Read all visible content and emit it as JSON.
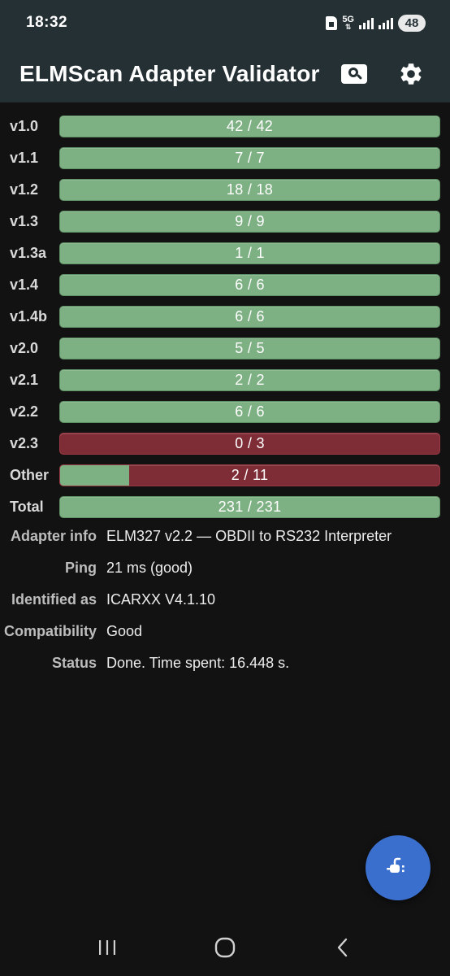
{
  "status_bar": {
    "time": "18:32",
    "network": "5G",
    "battery": "48"
  },
  "app_bar": {
    "title": "ELMScan Adapter Validator",
    "search_icon": "search-icon",
    "settings_icon": "gear-icon"
  },
  "colors": {
    "pass": "#7db082",
    "fail": "#7e2c35",
    "appbar": "#253035",
    "fab": "#3a6fce"
  },
  "results": [
    {
      "label": "v1.0",
      "value": "42 / 42",
      "passed": 42,
      "total": 42
    },
    {
      "label": "v1.1",
      "value": "7 / 7",
      "passed": 7,
      "total": 7
    },
    {
      "label": "v1.2",
      "value": "18 / 18",
      "passed": 18,
      "total": 18
    },
    {
      "label": "v1.3",
      "value": "9 / 9",
      "passed": 9,
      "total": 9
    },
    {
      "label": "v1.3a",
      "value": "1 / 1",
      "passed": 1,
      "total": 1
    },
    {
      "label": "v1.4",
      "value": "6 / 6",
      "passed": 6,
      "total": 6
    },
    {
      "label": "v1.4b",
      "value": "6 / 6",
      "passed": 6,
      "total": 6
    },
    {
      "label": "v2.0",
      "value": "5 / 5",
      "passed": 5,
      "total": 5
    },
    {
      "label": "v2.1",
      "value": "2 / 2",
      "passed": 2,
      "total": 2
    },
    {
      "label": "v2.2",
      "value": "6 / 6",
      "passed": 6,
      "total": 6
    },
    {
      "label": "v2.3",
      "value": "0 / 3",
      "passed": 0,
      "total": 3
    },
    {
      "label": "Other",
      "value": "2 / 11",
      "passed": 2,
      "total": 11
    },
    {
      "label": "Total",
      "value": "231 / 231",
      "passed": 231,
      "total": 231
    }
  ],
  "info": [
    {
      "label": "Adapter info",
      "value": "ELM327 v2.2 — OBDII to RS232 Interpreter"
    },
    {
      "label": "Ping",
      "value": "21 ms (good)"
    },
    {
      "label": "Identified as",
      "value": "ICARXX V4.1.10"
    },
    {
      "label": "Compatibility",
      "value": "Good"
    },
    {
      "label": "Status",
      "value": "Done. Time spent: 16.448 s."
    }
  ],
  "fab": {
    "icon": "plug-icon"
  },
  "nav": {
    "recents_icon": "recents-icon",
    "home_icon": "home-icon",
    "back_icon": "back-icon"
  }
}
